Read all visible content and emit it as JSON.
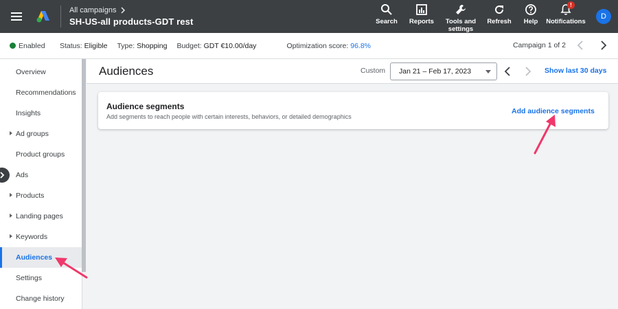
{
  "header": {
    "breadcrumb_parent": "All campaigns",
    "campaign_name": "SH-US-all products-GDT rest",
    "tools": [
      {
        "label": "Search",
        "icon": "search-icon"
      },
      {
        "label": "Reports",
        "icon": "reports-icon"
      },
      {
        "label": "Tools and settings",
        "icon": "wrench-icon"
      },
      {
        "label": "Refresh",
        "icon": "refresh-icon"
      },
      {
        "label": "Help",
        "icon": "help-icon"
      },
      {
        "label": "Notifications",
        "icon": "bell-icon"
      }
    ],
    "notification_badge": "!",
    "avatar_letter": "D"
  },
  "status": {
    "enabled": "Enabled",
    "status_label": "Status:",
    "status_value": "Eligible",
    "type_label": "Type:",
    "type_value": "Shopping",
    "budget_label": "Budget:",
    "budget_value": "GDT €10.00/day",
    "opt_label": "Optimization score:",
    "opt_value": "96.8%",
    "campaign_count": "Campaign 1 of 2"
  },
  "sidebar": {
    "items": [
      {
        "label": "Overview",
        "caret": false,
        "active": false
      },
      {
        "label": "Recommendations",
        "caret": false,
        "active": false
      },
      {
        "label": "Insights",
        "caret": false,
        "active": false
      },
      {
        "label": "Ad groups",
        "caret": true,
        "active": false
      },
      {
        "label": "Product groups",
        "caret": false,
        "active": false
      },
      {
        "label": "Ads",
        "caret": false,
        "active": false
      },
      {
        "label": "Products",
        "caret": true,
        "active": false
      },
      {
        "label": "Landing pages",
        "caret": true,
        "active": false
      },
      {
        "label": "Keywords",
        "caret": true,
        "active": false
      },
      {
        "label": "Audiences",
        "caret": false,
        "active": true
      },
      {
        "label": "Settings",
        "caret": false,
        "active": false
      },
      {
        "label": "Change history",
        "caret": false,
        "active": false
      }
    ]
  },
  "main": {
    "title": "Audiences",
    "range_label": "Custom",
    "date_range": "Jan 21 – Feb 17, 2023",
    "show_last": "Show last 30 days",
    "card": {
      "title": "Audience segments",
      "subtitle": "Add segments to reach people with certain interests, behaviors, or detailed demographics",
      "action": "Add audience segments"
    }
  },
  "colors": {
    "topbar": "#3c4043",
    "accent": "#1a73e8",
    "enabled_dot": "#188038",
    "annotation_arrow": "#f0386b"
  }
}
